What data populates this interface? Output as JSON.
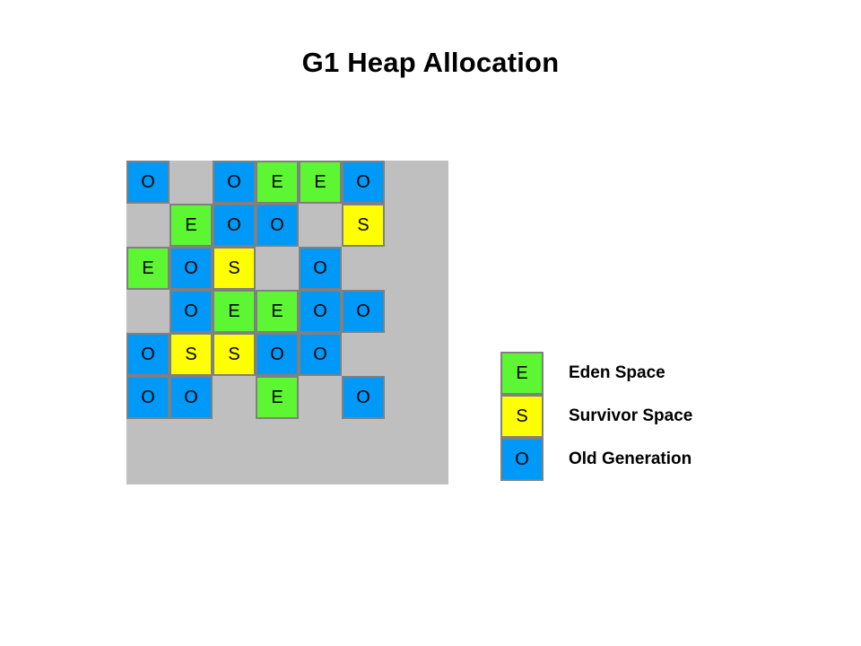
{
  "title": "G1 Heap Allocation",
  "colors": {
    "eden": "#5cf732",
    "survivor": "#ffff00",
    "old": "#0099f7",
    "panel_background": "#bfbfbf",
    "cell_border": "#808080",
    "page_background": "#ffffff",
    "text": "#000000"
  },
  "heap": {
    "rows": 6,
    "columns": 6,
    "grid": [
      [
        "O",
        "",
        "O",
        "E",
        "E",
        "O"
      ],
      [
        "",
        "E",
        "O",
        "O",
        "",
        "S"
      ],
      [
        "E",
        "O",
        "S",
        "",
        "O",
        ""
      ],
      [
        "",
        "O",
        "E",
        "E",
        "O",
        "O"
      ],
      [
        "O",
        "S",
        "S",
        "O",
        "O",
        ""
      ],
      [
        "O",
        "O",
        "",
        "E",
        "",
        "O"
      ]
    ],
    "counts": {
      "eden": 7,
      "survivor": 4,
      "old": 16,
      "empty": 9
    }
  },
  "legend": {
    "items": [
      {
        "symbol": "E",
        "label": "Eden Space",
        "color": "#5cf732"
      },
      {
        "symbol": "S",
        "label": "Survivor Space",
        "color": "#ffff00"
      },
      {
        "symbol": "O",
        "label": "Old Generation",
        "color": "#0099f7"
      }
    ]
  }
}
